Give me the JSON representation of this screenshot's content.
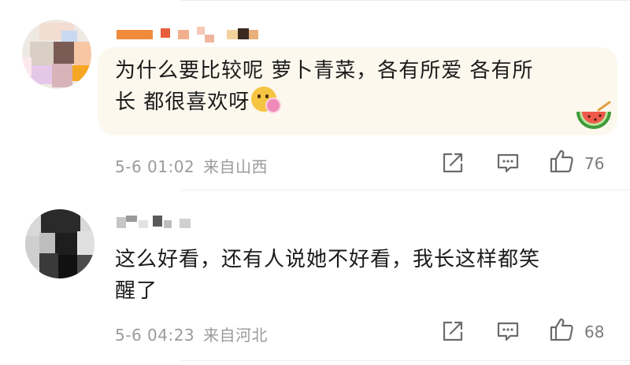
{
  "comments": [
    {
      "text_line1": "为什么要比较呢 萝卜青菜，各有所爱 各有所",
      "text_line2": "长 都很喜欢呀",
      "emoji_icon": "blush-flower-emoji-icon",
      "sticker_icon": "watermelon-icon",
      "timestamp": "5-6 01:02",
      "location": "来自山西",
      "likes": "76",
      "icons": [
        "share-icon",
        "comment-icon",
        "like-icon"
      ]
    },
    {
      "text_line1": "这么好看，还有人说她不好看，我长这样都笑",
      "text_line2": "醒了",
      "timestamp": "5-6 04:23",
      "location": "来自河北",
      "likes": "68",
      "icons": [
        "share-icon",
        "comment-icon",
        "like-icon"
      ]
    }
  ],
  "colors": {
    "bubble_bg": "#fdf8ed",
    "meta_text": "#9b9b9b",
    "body_text": "#1b1b1b",
    "username_accent": "#f08a3c"
  }
}
